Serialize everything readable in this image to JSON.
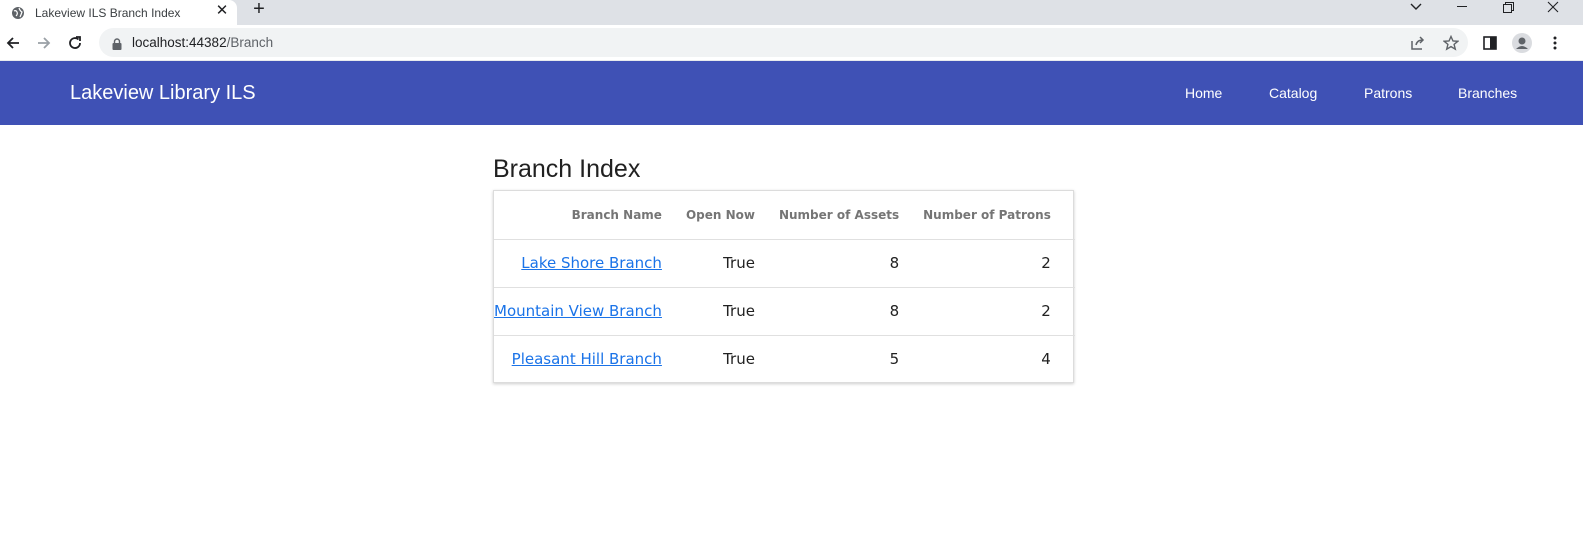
{
  "browser": {
    "tab_title": "Lakeview ILS Branch Index",
    "url_host": "localhost:44382",
    "url_path": "/Branch"
  },
  "app": {
    "brand": "Lakeview Library ILS",
    "nav": [
      "Home",
      "Catalog",
      "Patrons",
      "Branches"
    ],
    "accent_color": "#3f51b5"
  },
  "page": {
    "title": "Branch Index",
    "table": {
      "headers": [
        "Branch Name",
        "Open Now",
        "Number of Assets",
        "Number of Patrons"
      ],
      "rows": [
        {
          "name": "Lake Shore Branch",
          "open": "True",
          "assets": "8",
          "patrons": "2"
        },
        {
          "name": "Mountain View Branch",
          "open": "True",
          "assets": "8",
          "patrons": "2"
        },
        {
          "name": "Pleasant Hill Branch",
          "open": "True",
          "assets": "5",
          "patrons": "4"
        }
      ]
    }
  }
}
